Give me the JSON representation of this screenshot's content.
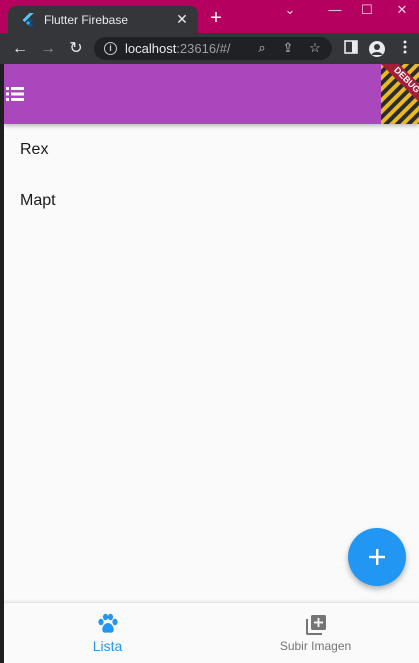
{
  "browser": {
    "tab": {
      "title": "Flutter Firebase",
      "favicon": "flutter-icon",
      "close_glyph": "✕"
    },
    "new_tab_glyph": "+",
    "window_controls": {
      "dropdown": "⌄",
      "minimize": "—",
      "maximize": "☐",
      "close": "✕"
    },
    "nav": {
      "back": "←",
      "forward": "→",
      "reload": "↻"
    },
    "url": {
      "host": "localhost",
      "rest": ":23616/#/"
    },
    "omnibox_icons": {
      "zoom": "⌕",
      "share": "⇪",
      "bookmark": "☆"
    }
  },
  "app": {
    "appbar": {
      "color": "#ab47bc",
      "menu_icon": "list-icon",
      "debug_banner": "DEBUG"
    },
    "items": [
      {
        "label": "Rex"
      },
      {
        "label": "Mapt"
      }
    ],
    "fab": {
      "icon": "add-icon",
      "color": "#2196f3"
    },
    "bottom_nav": {
      "items": [
        {
          "label": "Lista",
          "icon": "paw-icon",
          "active": true
        },
        {
          "label": "Subir Imagen",
          "icon": "add-photo-library-icon",
          "active": false
        }
      ]
    },
    "accent": "#2196f3"
  }
}
